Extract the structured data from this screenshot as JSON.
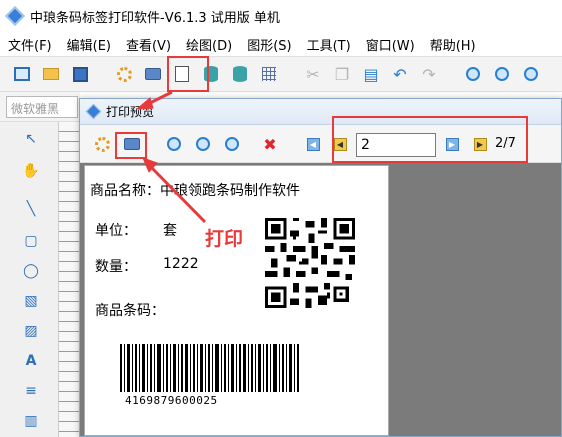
{
  "window": {
    "title": "中琅条码标签打印软件-V6.1.3 试用版 单机"
  },
  "menu": [
    "文件(F)",
    "编辑(E)",
    "查看(V)",
    "绘图(D)",
    "图形(S)",
    "工具(T)",
    "窗口(W)",
    "帮助(H)"
  ],
  "font_select": {
    "value": "微软雅黑"
  },
  "preview": {
    "title": "打印预览",
    "page_input": "2",
    "page_count": "2/7"
  },
  "label": {
    "product_name": "商品名称：中琅领跑条码制作软件",
    "unit_label": "单位：",
    "unit_value": "套",
    "qty_label": "数量：",
    "qty_value": "1222",
    "barcode_label": "商品条码：",
    "barcode_number": "4169879600025"
  },
  "annotation": {
    "text": "打印"
  },
  "colors": {
    "highlight": "#e83a3a",
    "accent": "#2a7fd0"
  }
}
